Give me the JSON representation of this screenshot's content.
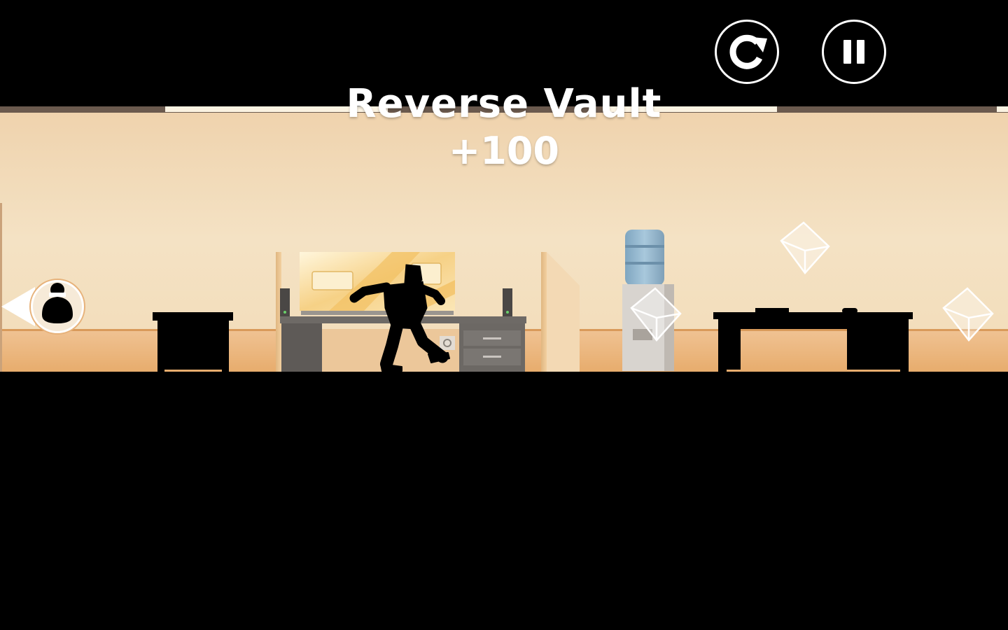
{
  "hud": {
    "restart_icon": "restart-icon",
    "pause_icon": "pause-icon"
  },
  "trick": {
    "name": "Reverse Vault",
    "score": "+100"
  },
  "chaser_indicator": {
    "icon": "hunter-avatar-icon",
    "direction": "left"
  },
  "colors": {
    "background": "#000000",
    "wall": "#f0dcba",
    "floor_trim": "#e8b47a",
    "hud_outline": "#ffffff"
  }
}
